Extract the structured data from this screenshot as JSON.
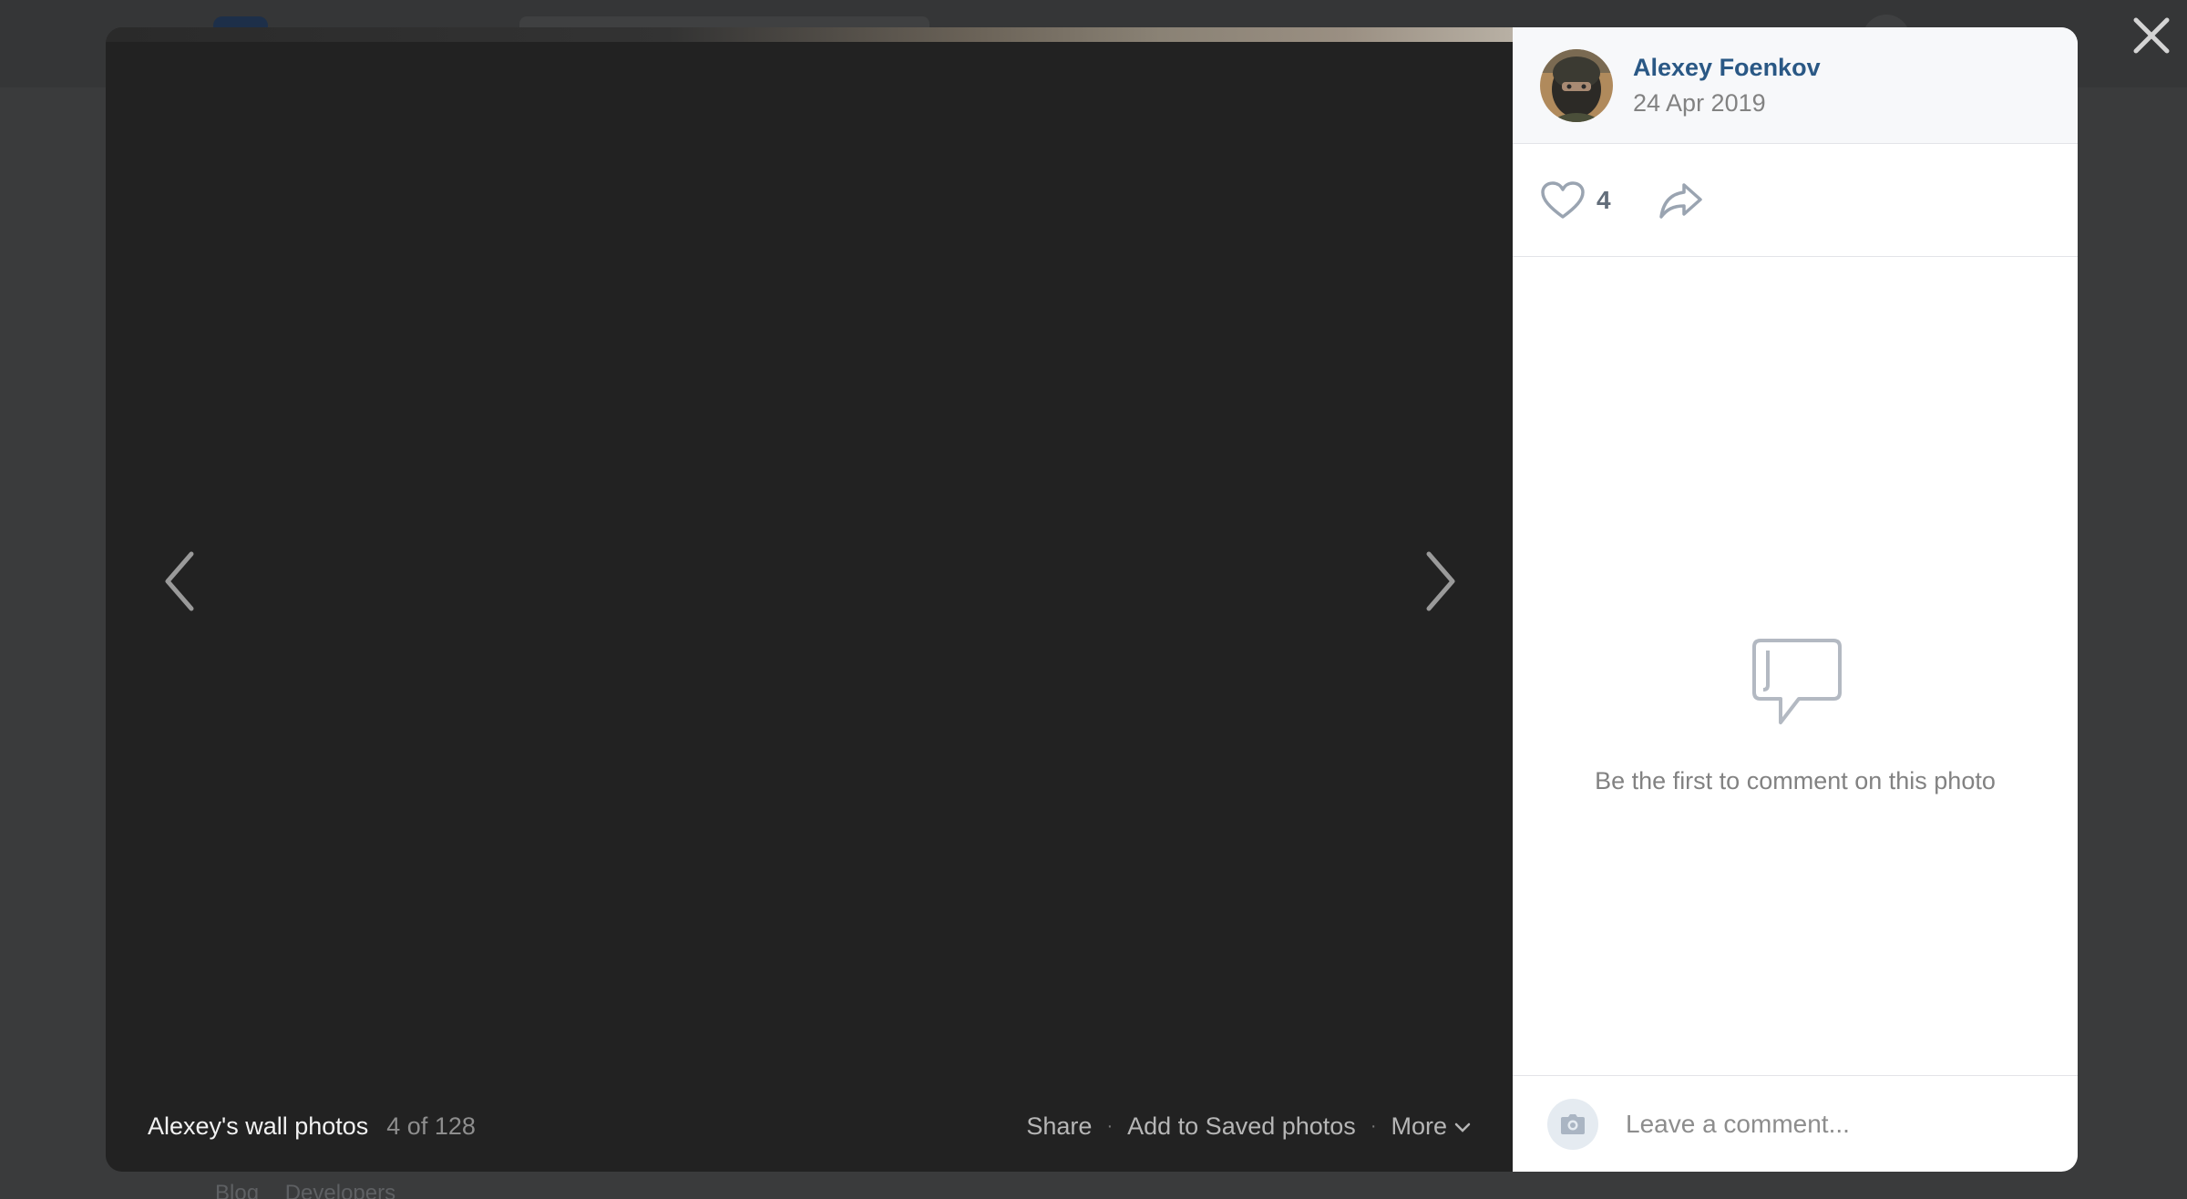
{
  "background_page": {
    "footer_links": [
      "Blog",
      "Developers"
    ]
  },
  "viewer": {
    "album_title": "Alexey's wall photos",
    "counter": "4 of 128",
    "actions": {
      "share": "Share",
      "save": "Add to Saved photos",
      "more": "More"
    },
    "separator": "·"
  },
  "sidebar": {
    "author_name": "Alexey Foenkov",
    "date": "24 Apr 2019",
    "likes": "4",
    "empty_comments": "Be the first to comment on this photo",
    "comment_placeholder": "Leave a comment..."
  },
  "icons": {
    "close": "close-icon",
    "prev": "chevron-left-icon",
    "next": "chevron-right-icon",
    "like": "heart-icon",
    "share": "share-arrow-icon",
    "comments": "speech-bubble-icon",
    "camera": "camera-icon",
    "more": "chevron-down-icon"
  },
  "colors": {
    "link": "#2a5885",
    "photo_bg": "#222222",
    "overlay": "#3a3b3c",
    "muted": "#828282"
  }
}
